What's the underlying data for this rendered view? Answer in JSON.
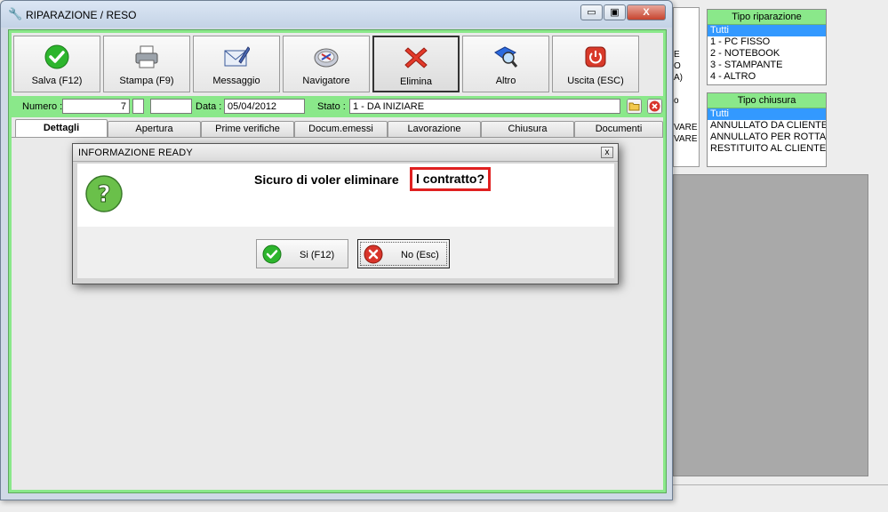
{
  "window": {
    "title": "RIPARAZIONE / RESO",
    "min_glyph": "▭",
    "max_glyph": "▣",
    "close_glyph": "X"
  },
  "toolbar": {
    "buttons": [
      {
        "label": "Salva (F12)",
        "icon": "check-icon"
      },
      {
        "label": "Stampa (F9)",
        "icon": "printer-icon"
      },
      {
        "label": "Messaggio",
        "icon": "mail-icon"
      },
      {
        "label": "Navigatore",
        "icon": "navigator-icon"
      },
      {
        "label": "Elimina",
        "icon": "delete-x-icon"
      },
      {
        "label": "Altro",
        "icon": "search-book-icon"
      },
      {
        "label": "Uscita (ESC)",
        "icon": "power-icon"
      }
    ]
  },
  "record": {
    "numero_label": "Numero :",
    "numero_value": "7",
    "data_label": "Data :",
    "data_value": "05/04/2012",
    "stato_label": "Stato :",
    "stato_value": "1 - DA INIZIARE"
  },
  "tabs": [
    "Dettagli",
    "Apertura",
    "Prime verifiche",
    "Docum.emessi",
    "Lavorazione",
    "Chiusura",
    "Documenti"
  ],
  "dialog": {
    "title": "INFORMAZIONE READY",
    "close_glyph": "x",
    "message_part1": "Sicuro di voler eliminare",
    "message_part2": "l contratto?",
    "yes_label": "Si (F12)",
    "no_label": "No (Esc)"
  },
  "side_panels": {
    "tipo_riparazione": {
      "header": "Tipo riparazione",
      "items": [
        "Tutti",
        "1 - PC FISSO",
        "2 - NOTEBOOK",
        "3 - STAMPANTE",
        "4 - ALTRO"
      ]
    },
    "tipo_chiusura": {
      "header": "Tipo chiusura",
      "items": [
        "Tutti",
        "ANNULLATO DA CLIENTE",
        "ANNULLATO PER ROTTA",
        "RESTITUITO AL CLIENTE"
      ]
    },
    "partial_list": [
      "E",
      "O",
      "A)",
      "o",
      "VARE",
      "VARE"
    ]
  },
  "colors": {
    "accent_green": "#8ae88a",
    "selection_blue": "#3399ff",
    "highlight_red": "#e02020"
  }
}
